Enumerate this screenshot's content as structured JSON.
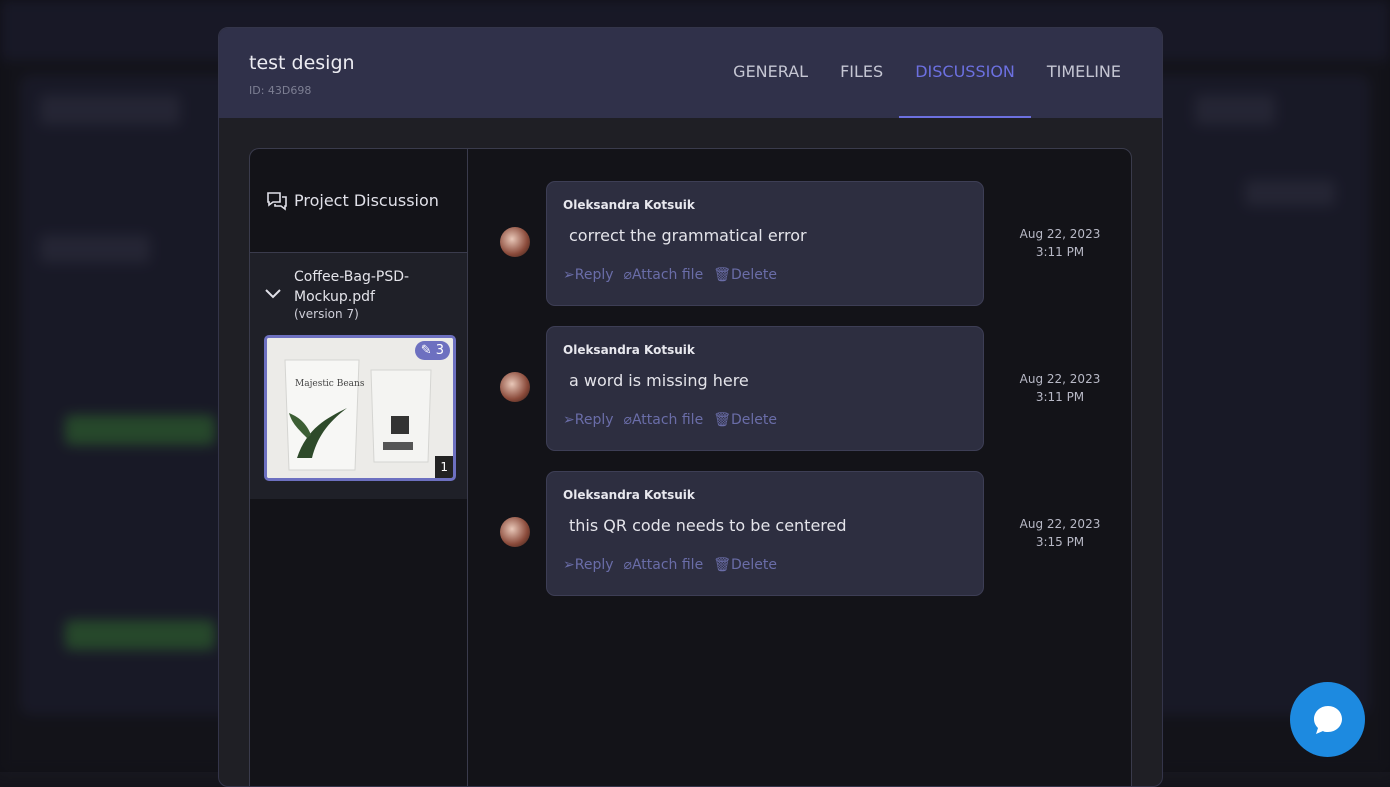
{
  "modal": {
    "title": "test design",
    "id": "ID: 43D698"
  },
  "tabs": [
    {
      "label": "GENERAL"
    },
    {
      "label": "FILES"
    },
    {
      "label": "DISCUSSION",
      "active": true
    },
    {
      "label": "TIMELINE"
    }
  ],
  "sidebar": {
    "heading": "Project Discussion",
    "file": {
      "name_line1": "Coffee-Bag-PSD-",
      "name_line2": "Mockup.pdf",
      "version": "(version 7)",
      "comment_count": "3",
      "page": "1"
    }
  },
  "actions": {
    "reply": "Reply",
    "attach": "Attach file",
    "delete": "Delete"
  },
  "messages": [
    {
      "author": "Oleksandra Kotsuik",
      "text": "correct the grammatical error",
      "date": "Aug 22, 2023",
      "time": "3:11 PM"
    },
    {
      "author": "Oleksandra Kotsuik",
      "text": "a word is missing here",
      "date": "Aug 22, 2023",
      "time": "3:11 PM"
    },
    {
      "author": "Oleksandra Kotsuik",
      "text": "this QR code needs to be centered",
      "date": "Aug 22, 2023",
      "time": "3:15 PM"
    }
  ],
  "colors": {
    "accent": "#6c70e0",
    "chat": "#1d8ae0"
  }
}
